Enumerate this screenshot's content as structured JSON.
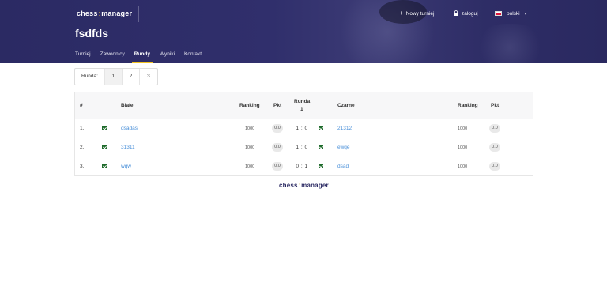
{
  "header": {
    "logo_left": "chess",
    "logo_sep": ":",
    "logo_right": "manager",
    "new_tournament_label": "Nowy turniej",
    "login_label": "zaloguj",
    "language_label": "polski",
    "title": "fsdfds"
  },
  "tabs": [
    {
      "label": "Turniej"
    },
    {
      "label": "Zawodnicy"
    },
    {
      "label": "Rundy"
    },
    {
      "label": "Wyniki"
    },
    {
      "label": "Kontakt"
    }
  ],
  "active_tab": "Rundy",
  "round_selector": {
    "label": "Runda:",
    "rounds": [
      "1",
      "2",
      "3"
    ],
    "selected": "1"
  },
  "table": {
    "headers": {
      "num": "#",
      "white": "Białe",
      "white_ranking": "Ranking",
      "white_pkt": "Pkt",
      "round_line1": "Runda",
      "round_line2": "1",
      "black": "Czarne",
      "black_ranking": "Ranking",
      "black_pkt": "Pkt"
    },
    "rows": [
      {
        "num": "1.",
        "white": "dsadas",
        "white_ranking": "1000",
        "white_pkt": "0.0",
        "score": "1 : 0",
        "black": "21312",
        "black_ranking": "1000",
        "black_pkt": "0.0"
      },
      {
        "num": "2.",
        "white": "31311",
        "white_ranking": "1000",
        "white_pkt": "0.0",
        "score": "1 : 0",
        "black": "ewqe",
        "black_ranking": "1000",
        "black_pkt": "0.0"
      },
      {
        "num": "3.",
        "white": "wqw",
        "white_ranking": "1000",
        "white_pkt": "0.0",
        "score": "0 : 1",
        "black": "dsad",
        "black_ranking": "1000",
        "black_pkt": "0.0"
      }
    ]
  },
  "footer": {
    "logo_left": "chess",
    "logo_sep": ":",
    "logo_right": "manager"
  },
  "colors": {
    "header_bg": "#2e2d66",
    "accent": "#f0c020",
    "link": "#4a90d9",
    "check": "#1f6b2c"
  }
}
